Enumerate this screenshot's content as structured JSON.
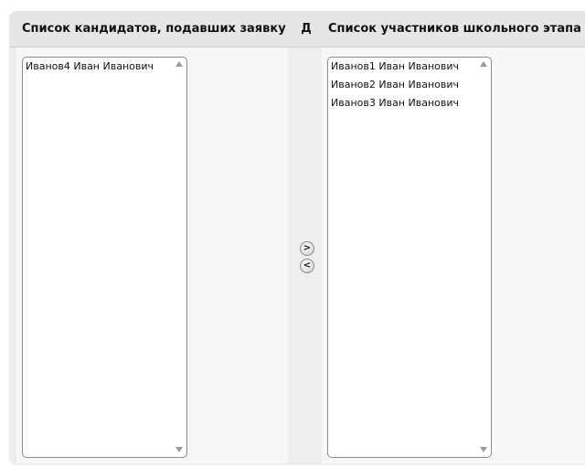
{
  "headers": {
    "left": "Список кандидатов, подавших заявку",
    "middle": "Д",
    "right": "Список участников школьного этапа"
  },
  "candidates": [
    "Иванов4 Иван Иванович"
  ],
  "participants": [
    "Иванов1 Иван Иванович",
    "Иванов2 Иван Иванович",
    "Иванов3 Иван Иванович"
  ],
  "buttons": {
    "add": ">",
    "remove": "<"
  }
}
